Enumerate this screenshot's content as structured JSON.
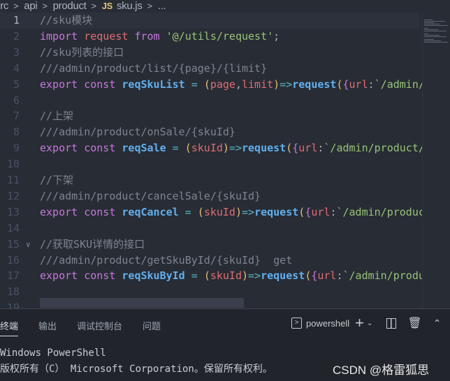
{
  "breadcrumb": [
    "src",
    "api",
    "product",
    "sku.js",
    "..."
  ],
  "file_icon": "JS",
  "lines": [
    [
      [
        "c",
        "//sku模块"
      ]
    ],
    [
      [
        "k",
        "import "
      ],
      [
        "v",
        "request "
      ],
      [
        "k",
        "from "
      ],
      [
        "s",
        "'@/utils/request'"
      ],
      [
        "p",
        ";"
      ]
    ],
    [
      [
        "c",
        "//sku列表的接口"
      ]
    ],
    [
      [
        "c",
        "///admin/product/list/{page}/{limit}"
      ]
    ],
    [
      [
        "k",
        "export "
      ],
      [
        "k",
        "const "
      ],
      [
        "f",
        "reqSkuList"
      ],
      [
        "o",
        " = "
      ],
      [
        "y",
        "("
      ],
      [
        "v",
        "page"
      ],
      [
        "p",
        ","
      ],
      [
        "v",
        "limit"
      ],
      [
        "y",
        ")"
      ],
      [
        "o",
        "=>"
      ],
      [
        "f",
        "request"
      ],
      [
        "y",
        "("
      ],
      [
        "pp",
        "{"
      ],
      [
        "v",
        "url"
      ],
      [
        "p",
        ":"
      ],
      [
        "s",
        "`/admin/product/list/"
      ]
    ],
    [],
    [
      [
        "c",
        "//上架"
      ]
    ],
    [
      [
        "c",
        "///admin/product/onSale/{skuId}"
      ]
    ],
    [
      [
        "k",
        "export "
      ],
      [
        "k",
        "const "
      ],
      [
        "f",
        "reqSale"
      ],
      [
        "o",
        " = "
      ],
      [
        "y",
        "("
      ],
      [
        "v",
        "skuId"
      ],
      [
        "y",
        ")"
      ],
      [
        "o",
        "=>"
      ],
      [
        "f",
        "request"
      ],
      [
        "y",
        "("
      ],
      [
        "pp",
        "{"
      ],
      [
        "v",
        "url"
      ],
      [
        "p",
        ":"
      ],
      [
        "s",
        "`/admin/product/onSale/"
      ]
    ],
    [],
    [
      [
        "c",
        "//下架"
      ]
    ],
    [
      [
        "c",
        "///admin/product/cancelSale/{skuId}"
      ]
    ],
    [
      [
        "k",
        "export "
      ],
      [
        "k",
        "const "
      ],
      [
        "f",
        "reqCancel"
      ],
      [
        "o",
        " = "
      ],
      [
        "y",
        "("
      ],
      [
        "v",
        "skuId"
      ],
      [
        "y",
        ")"
      ],
      [
        "o",
        "=>"
      ],
      [
        "f",
        "request"
      ],
      [
        "y",
        "("
      ],
      [
        "pp",
        "{"
      ],
      [
        "v",
        "url"
      ],
      [
        "p",
        ":"
      ],
      [
        "s",
        "`/admin/product/cancelSale/"
      ]
    ],
    [],
    [
      [
        "c",
        "//获取SKU详情的接口"
      ]
    ],
    [
      [
        "c",
        "///admin/product/getSkuById/{skuId}  get"
      ]
    ],
    [
      [
        "k",
        "export "
      ],
      [
        "k",
        "const "
      ],
      [
        "f",
        "reqSkuById"
      ],
      [
        "o",
        " = "
      ],
      [
        "y",
        "("
      ],
      [
        "v",
        "skuId"
      ],
      [
        "y",
        ")"
      ],
      [
        "o",
        "=>"
      ],
      [
        "f",
        "request"
      ],
      [
        "y",
        "("
      ],
      [
        "pp",
        "{"
      ],
      [
        "v",
        "url"
      ],
      [
        "p",
        ":"
      ],
      [
        "s",
        "`/admin/product/getSkuById/"
      ]
    ],
    []
  ],
  "line_count": 19,
  "panel": {
    "tabs": [
      "终端",
      "输出",
      "调试控制台",
      "问题"
    ],
    "active_tab": 0,
    "shell": "powershell",
    "output": [
      "Windows PowerShell",
      "版权所有（C） Microsoft Corporation。保留所有权利。"
    ]
  },
  "watermark": "CSDN @格雷狐思",
  "colors": {
    "background": "#282c34",
    "panel": "#21252b",
    "comment": "#7f848e",
    "keyword": "#c678dd",
    "function": "#61afef",
    "string": "#98c379"
  }
}
